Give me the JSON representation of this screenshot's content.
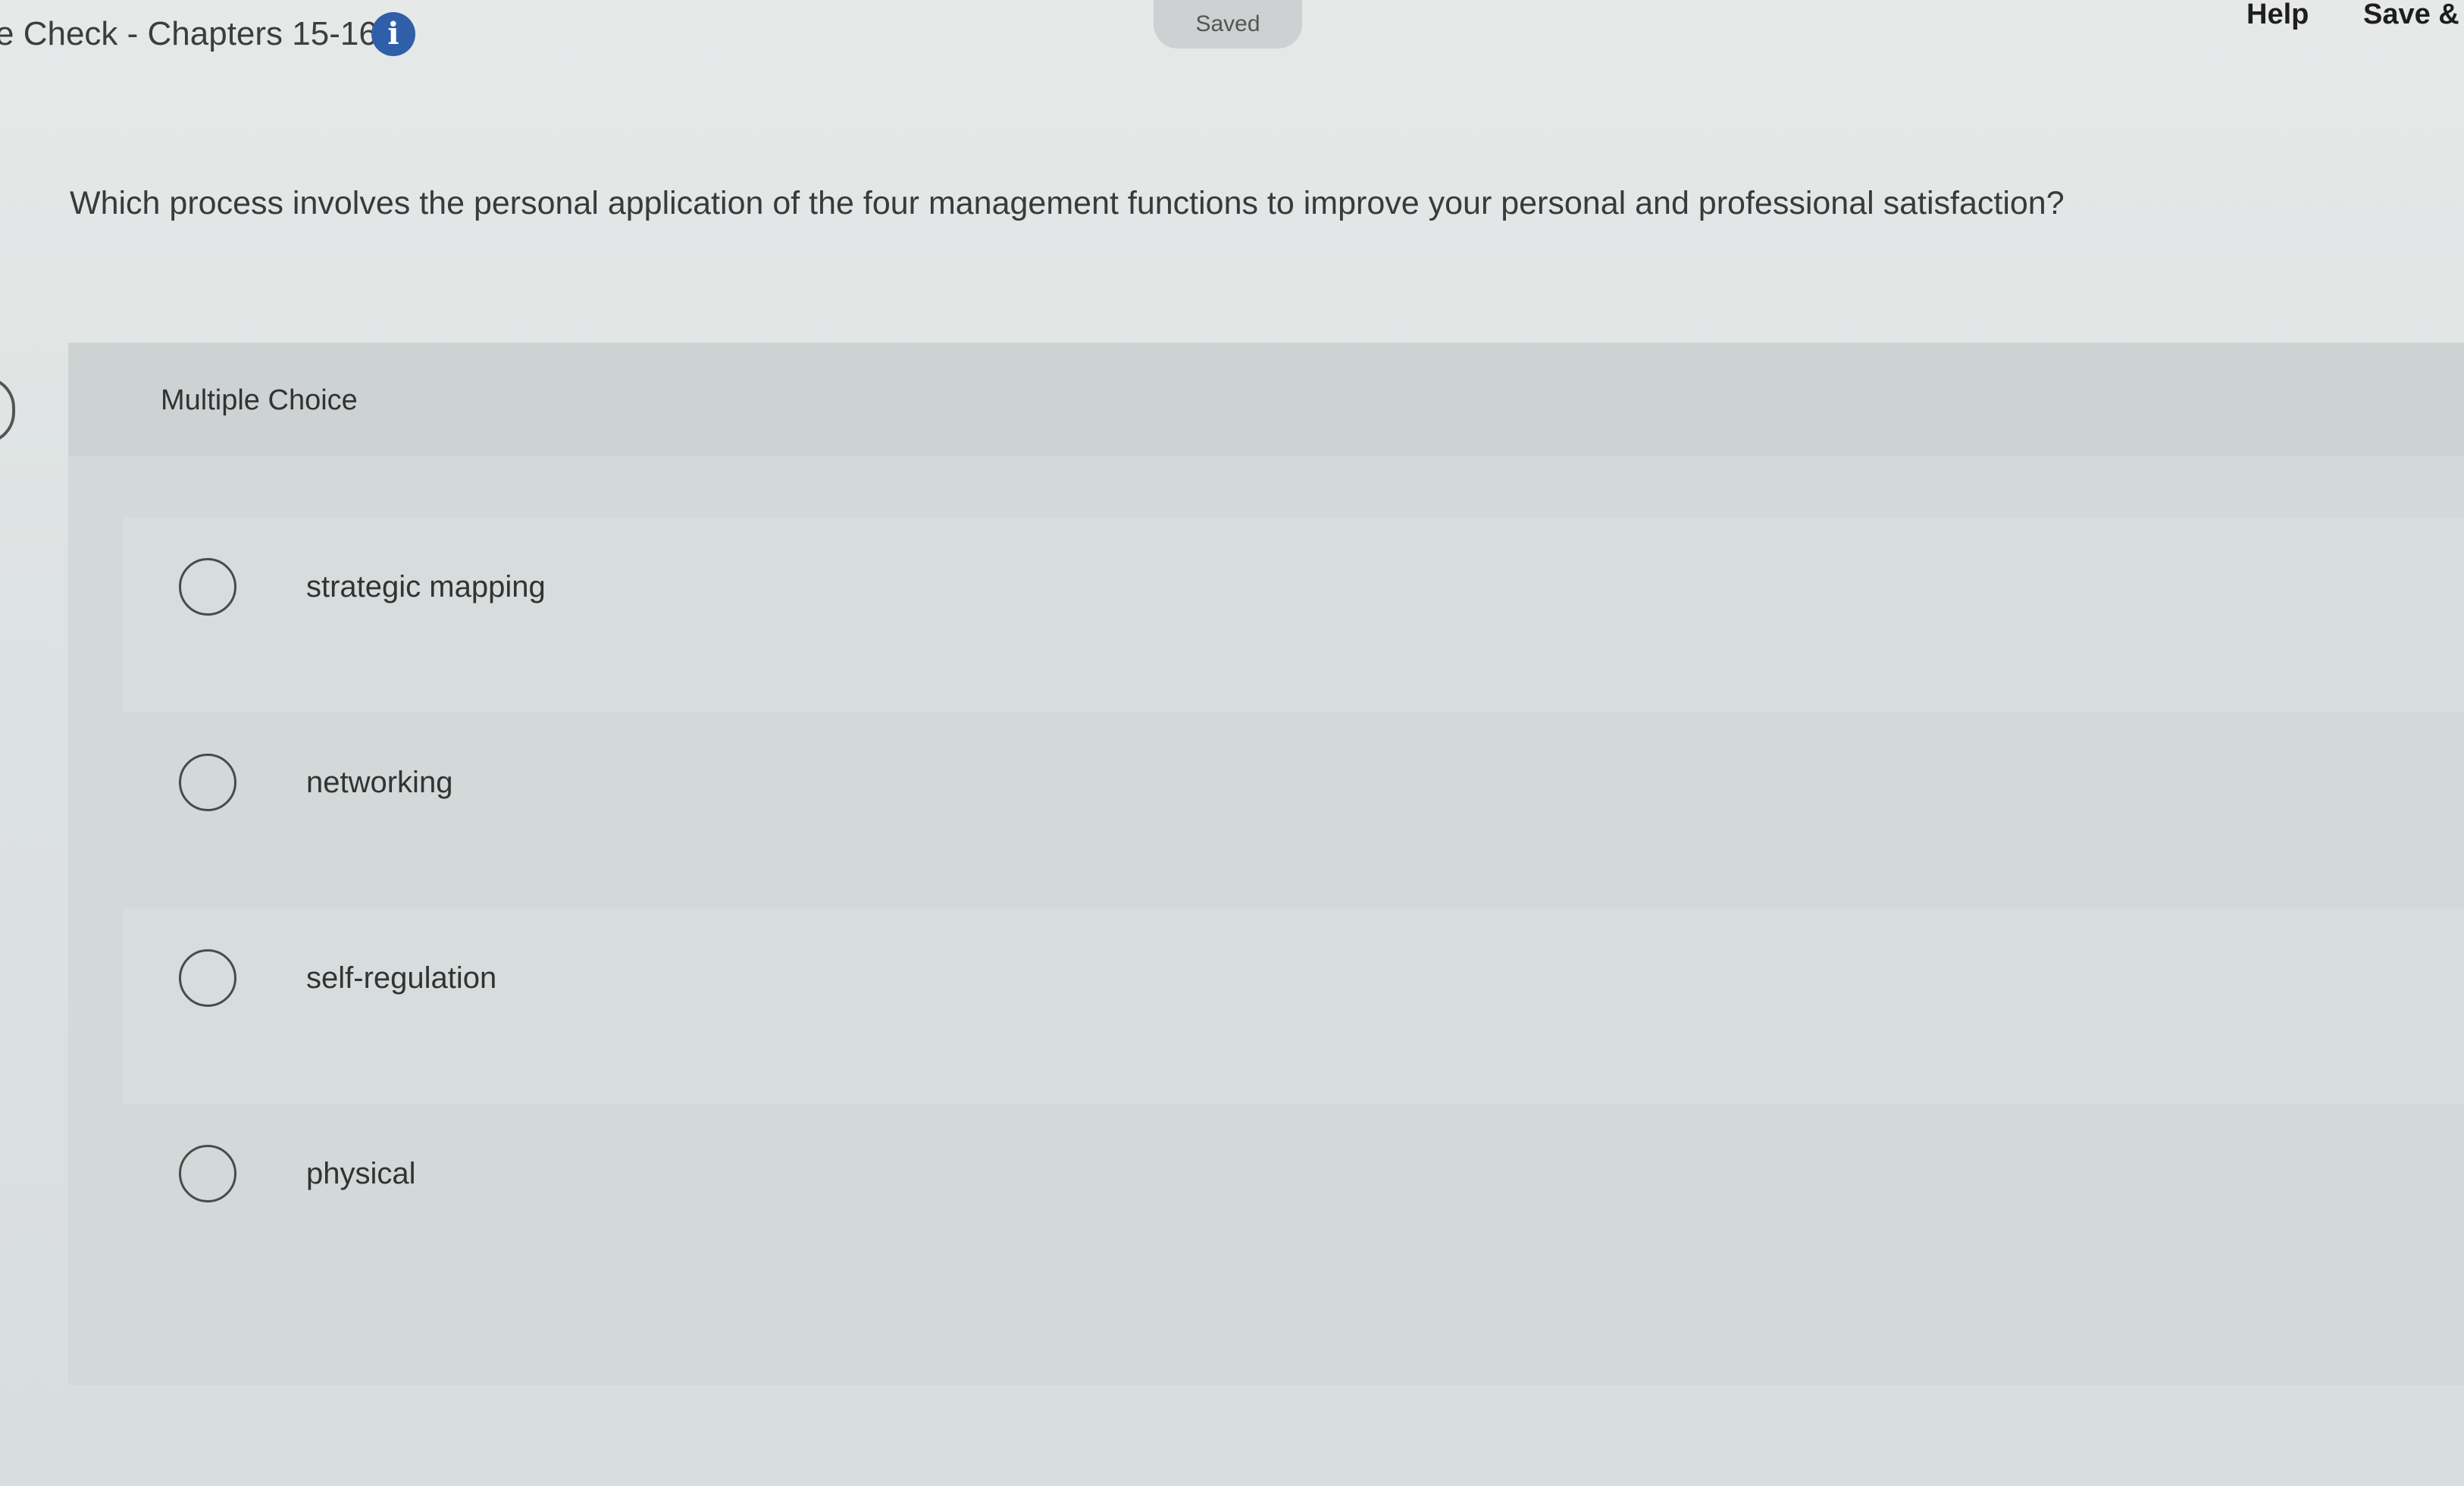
{
  "header": {
    "title": "e Check - Chapters 15-16",
    "info_icon": "info-icon",
    "status": "Saved",
    "help_label": "Help",
    "save_label": "Save &"
  },
  "question": {
    "text": "Which process involves the personal application of the four management functions to improve your personal and professional satisfaction?",
    "type": "Multiple Choice",
    "options": [
      {
        "label": "strategic mapping",
        "selected": false
      },
      {
        "label": "networking",
        "selected": false
      },
      {
        "label": "self-regulation",
        "selected": false
      },
      {
        "label": "physical",
        "selected": false
      }
    ]
  },
  "colors": {
    "info_icon": "#2f5fa8",
    "background": "#dde2e2"
  }
}
